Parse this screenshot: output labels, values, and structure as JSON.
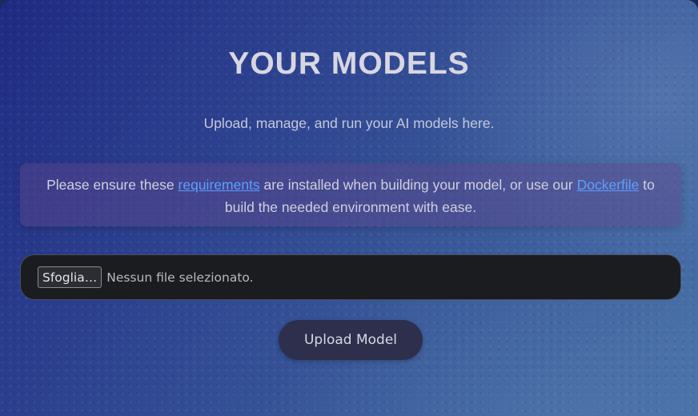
{
  "header": {
    "title": "YOUR MODELS",
    "subtitle": "Upload, manage, and run your AI models here."
  },
  "notice": {
    "text_before": "Please ensure these ",
    "requirements_link": "requirements",
    "text_middle": " are installed when building your model, or use our ",
    "dockerfile_link": "Dockerfile",
    "text_after": " to build the needed environment with ease.",
    "link_color": "#5aa0ff"
  },
  "file_input": {
    "browse_label": "Sfoglia…",
    "status": "Nessun file selezionato."
  },
  "actions": {
    "upload_label": "Upload Model"
  }
}
